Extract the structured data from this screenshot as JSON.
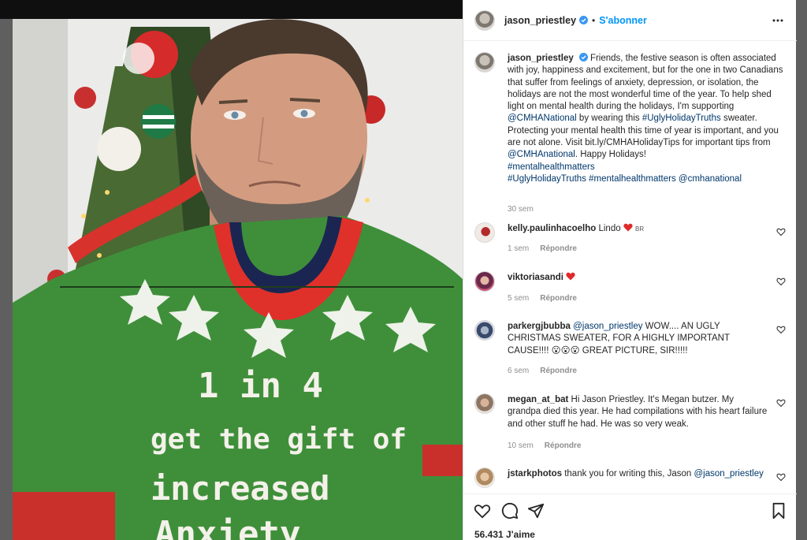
{
  "post": {
    "author": "jason_priestley",
    "follow_label": "S'abonner",
    "separator": "•",
    "photo_sweater_line1": "1 in 4",
    "photo_sweater_line2": "get the gift of",
    "photo_sweater_line3": "increased",
    "photo_sweater_line4": "Anxiety"
  },
  "caption": {
    "text_a": "Friends, the festive season is often associated with joy, happiness and excitement, but for the one in two Canadians that suffer from feelings of anxiety, depression, or isolation, the holidays are not the most wonderful time of the year. To help shed light on mental health during the holidays, I'm supporting ",
    "mention1": "@CMHANational",
    "text_b": " by wearing this ",
    "tag1": "#UglyHolidayTruths",
    "text_c": " sweater. Protecting your mental health this time of year is important, and you are not alone. Visit bit.ly/CMHAHolidayTips for important tips from ",
    "mention2": "@CMHAnational",
    "text_d": ". Happy Holidays! ",
    "tag2": "#mentalhealthmatters",
    "tag3": "#UglyHolidayTruths",
    "tag4": "#mentalhealthmatters",
    "mention3": "@cmhanational",
    "time": "30 sem"
  },
  "comments": [
    {
      "user": "kelly.paulinhacoelho",
      "text": "Lindo",
      "suffix": "BR",
      "time": "1 sem",
      "reply": "Répondre"
    },
    {
      "user": "viktoriasandi",
      "text": "",
      "time": "5 sem",
      "reply": "Répondre"
    },
    {
      "user": "parkergjbubba",
      "mention": "@jason_priestley",
      "text": " WOW.... AN UGLY CHRISTMAS SWEATER, FOR A HIGHLY IMPORTANT CAUSE!!!!",
      "emojis": "😮😮😮",
      "text2": " GREAT PICTURE, SIR!!!!!",
      "time": "6 sem",
      "reply": "Répondre"
    },
    {
      "user": "megan_at_bat",
      "text": "Hi Jason Priestley. It's Megan butzer. My grandpa died this year. He had compilations with his heart failure and other stuff he had. He was so very weak.",
      "time": "10 sem",
      "reply": "Répondre"
    },
    {
      "user": "jstarkphotos",
      "text": "thank you for writing this, Jason ",
      "mention": "@jason_priestley"
    }
  ],
  "likes": {
    "count_label": "56.431 J'aime"
  },
  "icons": {
    "like": "heart-icon",
    "comment": "comment-icon",
    "share": "share-icon",
    "save": "bookmark-icon",
    "more": "more-options-icon",
    "verified": "verified-badge-icon"
  },
  "colors": {
    "link": "#00376b",
    "follow": "#0095f6",
    "verified": "#3897f0",
    "heart_red": "#ed4956",
    "sweater_green": "#3f8f3a",
    "collar_red": "#e0302a"
  }
}
